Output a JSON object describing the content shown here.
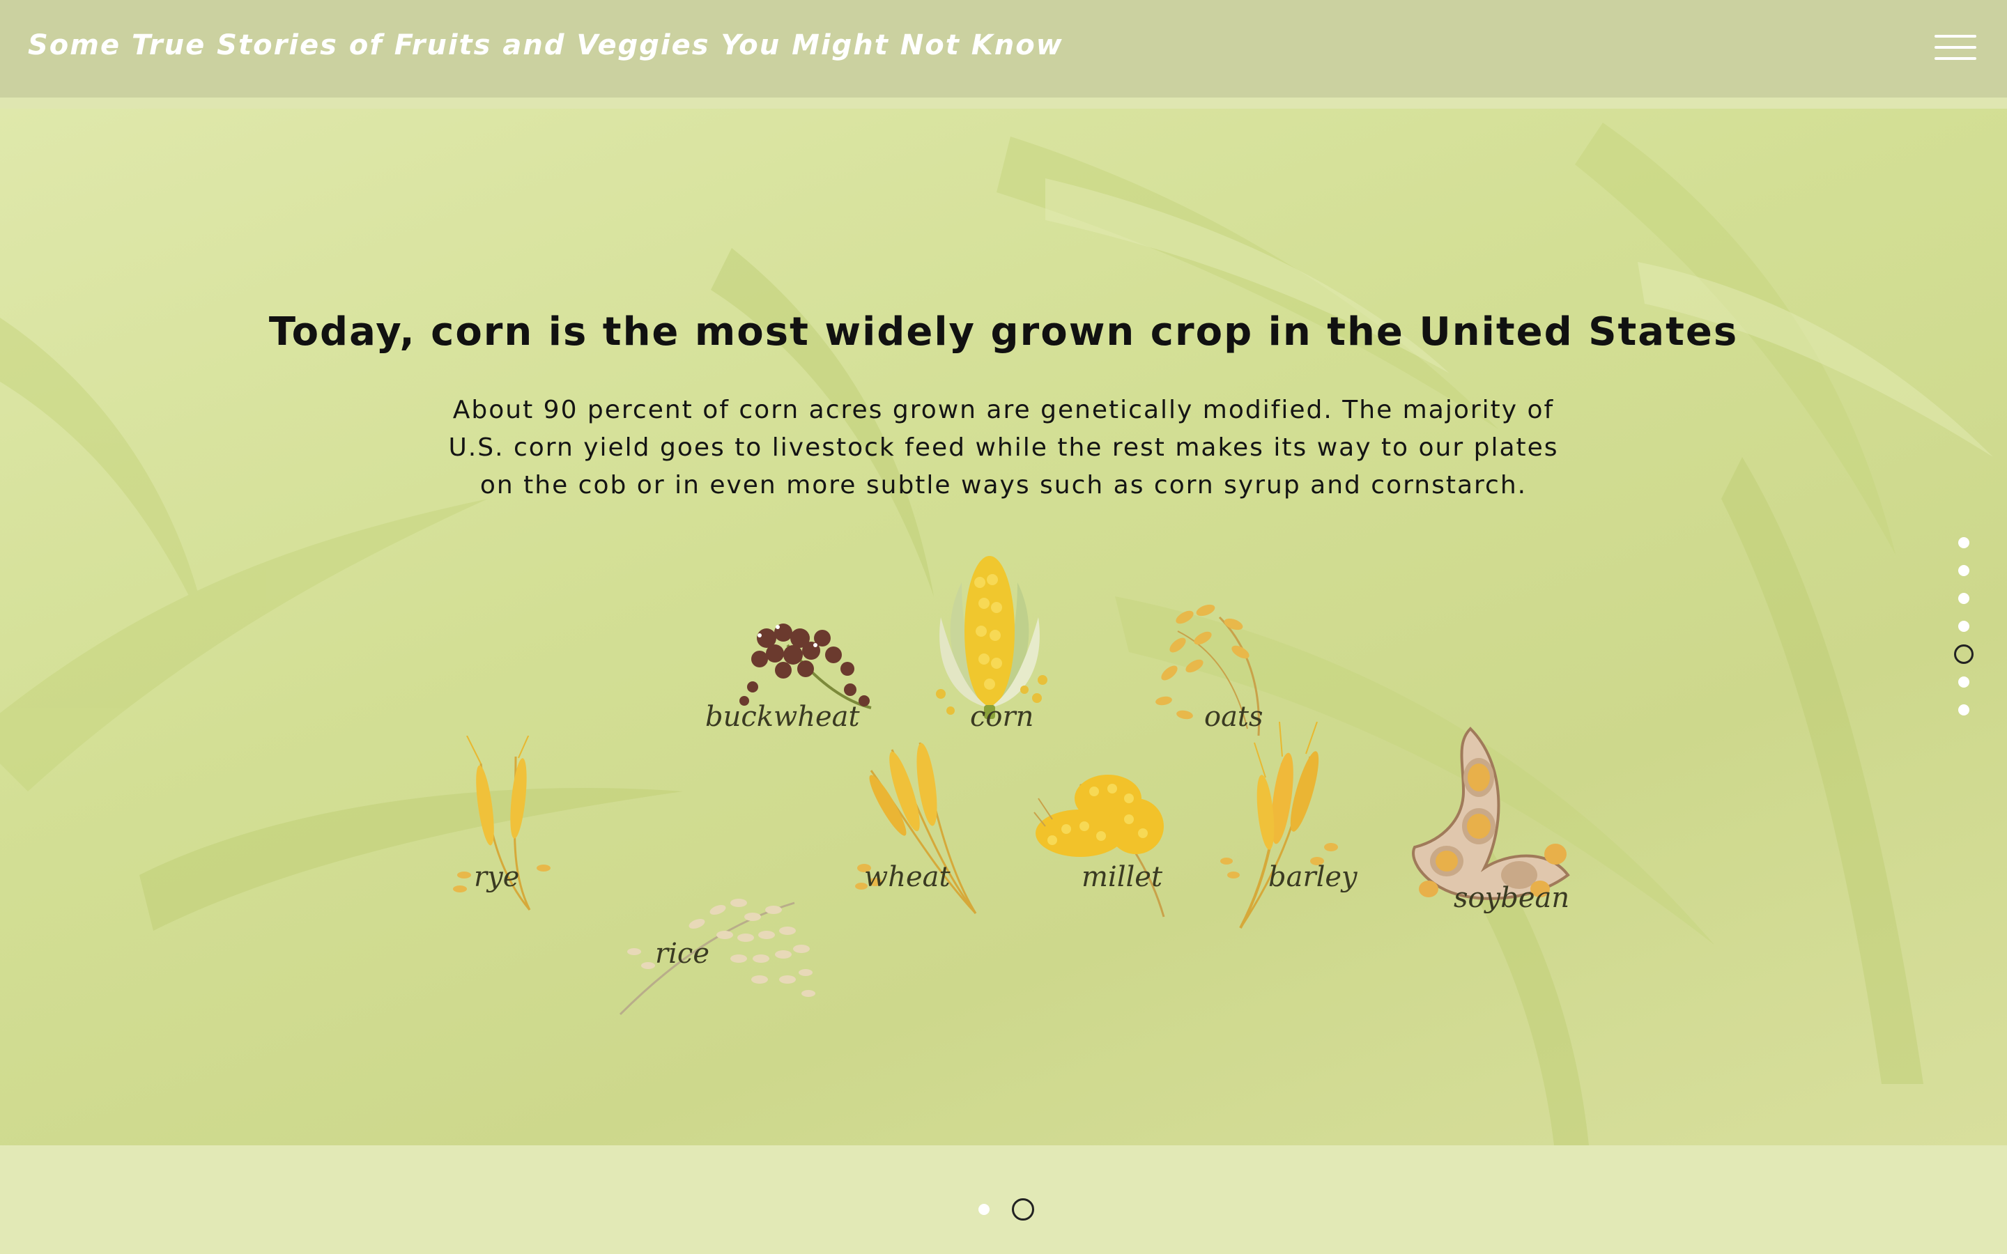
{
  "header": {
    "site_title": "Some True Stories of Fruits and Veggies You Might Not Know",
    "menu_icon": "hamburger-icon"
  },
  "slide": {
    "headline": "Today, corn is the most widely grown crop in the United States",
    "body": "About 90 percent of corn acres grown are genetically modified. The majority of U.S. corn yield goes to livestock feed while the rest makes its way to our plates on the cob or in even more subtle ways such as corn syrup and cornstarch.",
    "crops": {
      "buckwheat": "buckwheat",
      "corn": "corn",
      "oats": "oats",
      "rye": "rye",
      "rice": "rice",
      "wheat": "wheat",
      "millet": "millet",
      "barley": "barley",
      "soybean": "soybean"
    }
  },
  "section_nav": {
    "count": 7,
    "active_index": 4
  },
  "slide_nav": {
    "count": 2,
    "active_index": 1
  },
  "colors": {
    "header_bg": "#cbd1a0",
    "hero_tint": "#d3df95",
    "footer_bg": "#e2e9b6",
    "grain_gold": "#e8b92e",
    "buckwheat_brown": "#6b3a2e"
  }
}
